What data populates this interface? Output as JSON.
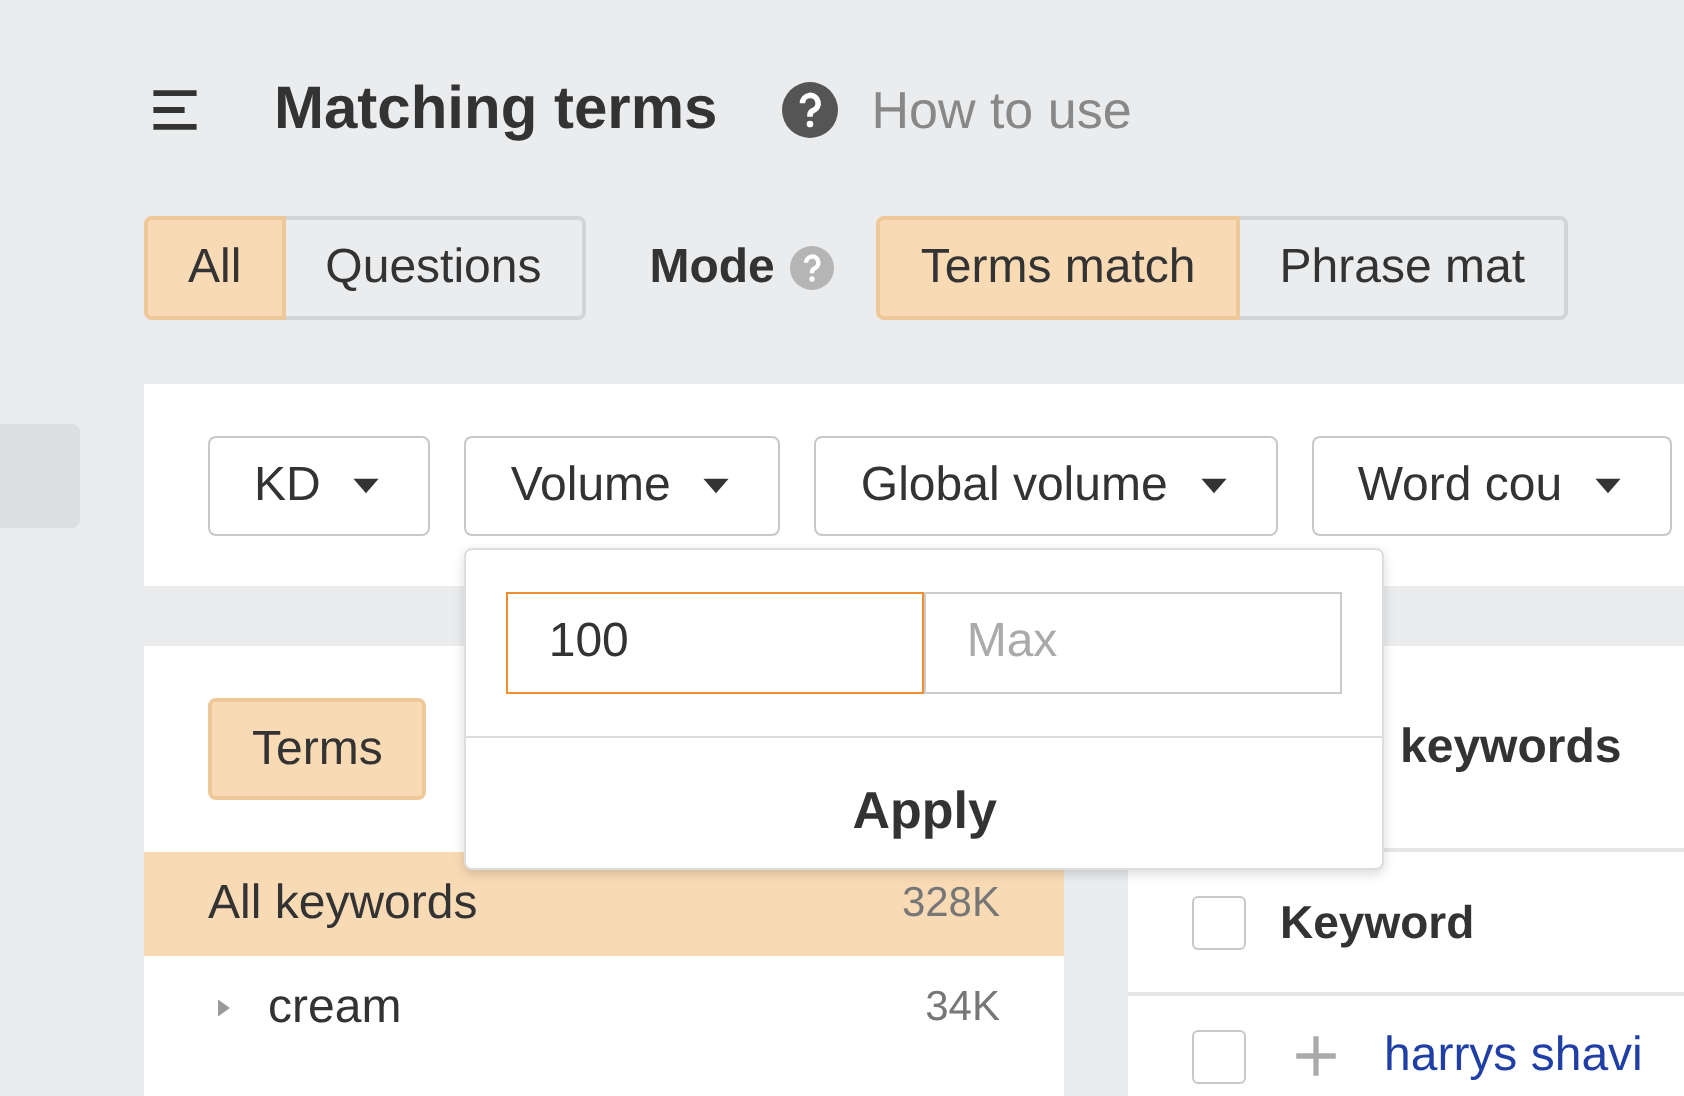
{
  "header": {
    "title": "Matching terms",
    "help_link": "How to use"
  },
  "question_filter": [
    {
      "label": "All",
      "selected": true
    },
    {
      "label": "Questions",
      "selected": false
    }
  ],
  "mode": {
    "label": "Mode",
    "options": [
      {
        "label": "Terms match",
        "selected": true
      },
      {
        "label": "Phrase mat",
        "selected": false
      }
    ]
  },
  "filters": [
    {
      "label": "KD"
    },
    {
      "label": "Volume",
      "popup": {
        "min_value": "100",
        "max_placeholder": "Max",
        "button": "Apply"
      }
    },
    {
      "label": "Global volume"
    },
    {
      "label": "Word cou"
    }
  ],
  "groups_panel": {
    "tab": "Terms",
    "groups": [
      {
        "label": "All keywords",
        "count": "328K",
        "selected": true,
        "expandable": false
      },
      {
        "label": "cream",
        "count": "34K",
        "selected": false,
        "expandable": true
      }
    ]
  },
  "keywords_panel": {
    "title": "keywords",
    "column": "Keyword",
    "header_checked": false,
    "rows": [
      {
        "keyword": "harrys shavi",
        "checked": false
      }
    ]
  }
}
